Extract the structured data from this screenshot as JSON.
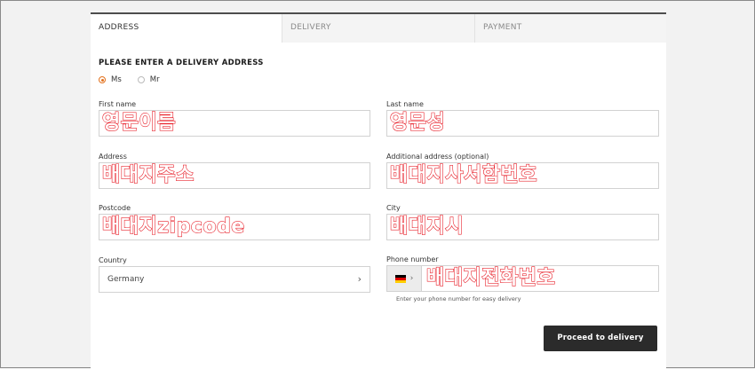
{
  "tabs": [
    {
      "label": "ADDRESS"
    },
    {
      "label": "DELIVERY"
    },
    {
      "label": "PAYMENT"
    }
  ],
  "form": {
    "heading": "PLEASE ENTER A DELIVERY ADDRESS",
    "salutation": {
      "options": [
        "Ms",
        "Mr"
      ],
      "selected": "Ms"
    },
    "first_name": {
      "label": "First name",
      "value": "영문이름"
    },
    "last_name": {
      "label": "Last name",
      "value": "영문성"
    },
    "address": {
      "label": "Address",
      "value": "배대지주소"
    },
    "additional_address": {
      "label": "Additional address (optional)",
      "value": "배대지사서함번호"
    },
    "postcode": {
      "label": "Postcode",
      "value": "배대지zipcode"
    },
    "city": {
      "label": "City",
      "value": "배대지시"
    },
    "country": {
      "label": "Country",
      "value": "Germany",
      "icon": "chevron-right-icon"
    },
    "phone": {
      "label": "Phone number",
      "value": "배대지전화번호",
      "flag_icon": "germany-flag-icon",
      "flag_colors": [
        "#000000",
        "#dd0000",
        "#ffce00"
      ],
      "hint": "Enter your phone number for easy delivery"
    },
    "proceed_label": "Proceed to delivery"
  },
  "colors": {
    "accent": "#e2711d",
    "annotation_red": "#e8202a",
    "button_bg": "#2b2b2b"
  }
}
